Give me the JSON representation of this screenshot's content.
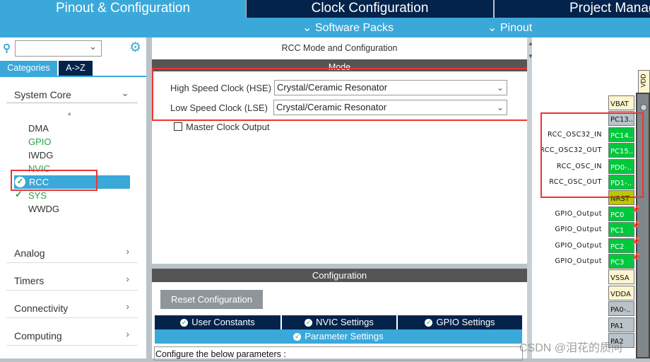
{
  "top_tabs": [
    {
      "label": "Pinout & Configuration",
      "active": true
    },
    {
      "label": "Clock Configuration",
      "active": false
    },
    {
      "label": "Project Manager",
      "active": false
    }
  ],
  "sub_menu": {
    "software_packs": "Software Packs",
    "pinout": "Pinout"
  },
  "left_panel": {
    "search_value": "",
    "tabs": [
      "Categories",
      "A->Z"
    ],
    "system_core": {
      "label": "System Core",
      "items": [
        {
          "label": "DMA",
          "state": "normal"
        },
        {
          "label": "GPIO",
          "state": "configured"
        },
        {
          "label": "IWDG",
          "state": "normal"
        },
        {
          "label": "NVIC",
          "state": "configured"
        },
        {
          "label": "RCC",
          "state": "selected"
        },
        {
          "label": "SYS",
          "state": "configured"
        },
        {
          "label": "WWDG",
          "state": "normal"
        }
      ]
    },
    "categories": [
      "Analog",
      "Timers",
      "Connectivity",
      "Computing"
    ]
  },
  "mode_panel": {
    "title": "RCC Mode and Configuration",
    "mode_header": "Mode",
    "hse_label": "High Speed Clock (HSE)",
    "hse_value": "Crystal/Ceramic Resonator",
    "lse_label": "Low Speed Clock (LSE)",
    "lse_value": "Crystal/Ceramic Resonator",
    "mco_label": "Master Clock Output",
    "mco_checked": false
  },
  "config_panel": {
    "header": "Configuration",
    "reset_button": "Reset Configuration",
    "tabs": [
      "User Constants",
      "NVIC Settings",
      "GPIO Settings"
    ],
    "active_tab": "Parameter Settings",
    "hint": "Configure the below parameters :"
  },
  "pinout": {
    "top_pin": "VDD",
    "pins": [
      {
        "name": "VBAT",
        "signal": "",
        "color": "#fdf5cf"
      },
      {
        "name": "PC13..",
        "signal": "",
        "color": "#b9c3c9"
      },
      {
        "name": "PC14..",
        "signal": "RCC_OSC32_IN",
        "color": "#00c83c"
      },
      {
        "name": "PC15..",
        "signal": "RCC_OSC32_OUT",
        "color": "#00c83c"
      },
      {
        "name": "PD0-..",
        "signal": "RCC_OSC_IN",
        "color": "#00c83c"
      },
      {
        "name": "PD1-..",
        "signal": "RCC_OSC_OUT",
        "color": "#00c83c"
      },
      {
        "name": "NRST",
        "signal": "",
        "color": "#b9c800"
      },
      {
        "name": "PC0",
        "signal": "GPIO_Output",
        "color": "#00c83c"
      },
      {
        "name": "PC1",
        "signal": "GPIO_Output",
        "color": "#00c83c"
      },
      {
        "name": "PC2",
        "signal": "GPIO_Output",
        "color": "#00c83c"
      },
      {
        "name": "PC3",
        "signal": "GPIO_Output",
        "color": "#00c83c"
      },
      {
        "name": "VSSA",
        "signal": "",
        "color": "#fdf5cf"
      },
      {
        "name": "VDDA",
        "signal": "",
        "color": "#fdf5cf"
      },
      {
        "name": "PA0-..",
        "signal": "",
        "color": "#b9c3c9"
      },
      {
        "name": "PA1",
        "signal": "",
        "color": "#b9c3c9"
      },
      {
        "name": "PA2",
        "signal": "",
        "color": "#b9c3c9"
      }
    ]
  },
  "watermark": "CSDN @泪花的质问",
  "colors": {
    "accent": "#3ba8da",
    "navy": "#03234b",
    "configured": "#27a149",
    "highlight": "#e33333"
  }
}
